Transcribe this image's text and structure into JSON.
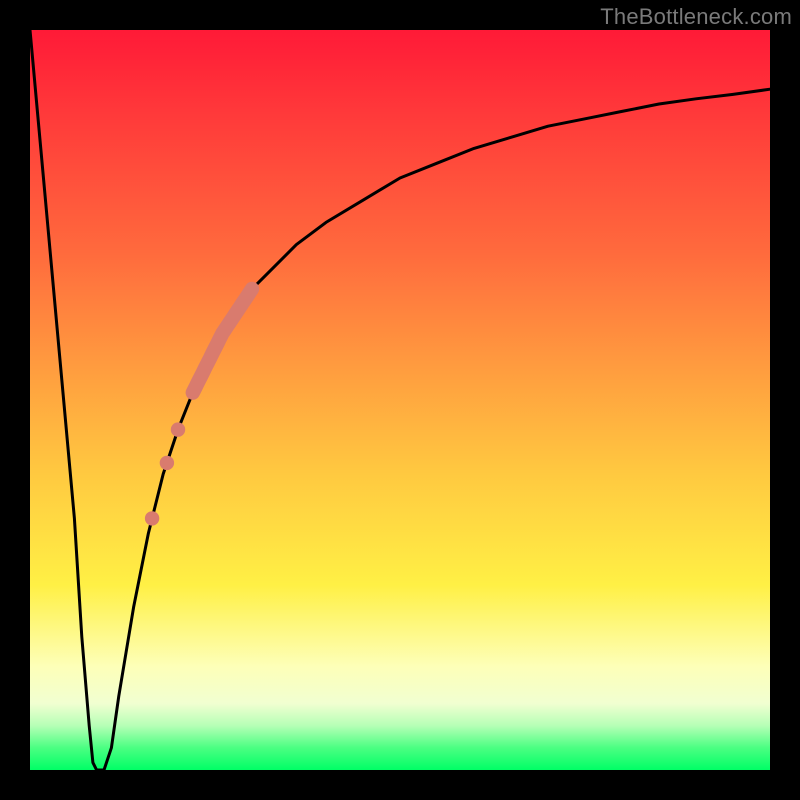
{
  "watermark": "TheBottleneck.com",
  "colors": {
    "background": "#000000",
    "curve": "#000000",
    "marker": "#d97b6e",
    "gradient_stops": [
      "#ff1a37",
      "#ff3b3a",
      "#ff6a3d",
      "#ff9a3f",
      "#ffc940",
      "#fff045",
      "#fdffb8",
      "#f1ffd1",
      "#b6ffb6",
      "#4bff82",
      "#00ff66"
    ]
  },
  "chart_data": {
    "type": "line",
    "title": "",
    "xlabel": "",
    "ylabel": "",
    "xlim": [
      0,
      100
    ],
    "ylim": [
      0,
      100
    ],
    "series": [
      {
        "name": "bottleneck-curve",
        "x": [
          0,
          2,
          4,
          6,
          7,
          8,
          8.5,
          9,
          9.5,
          10,
          11,
          12,
          14,
          16,
          18,
          20,
          22,
          24,
          26,
          28,
          30,
          33,
          36,
          40,
          45,
          50,
          55,
          60,
          65,
          70,
          75,
          80,
          85,
          90,
          95,
          100
        ],
        "values": [
          100,
          78,
          56,
          34,
          18,
          6,
          1,
          0,
          0,
          0,
          3,
          10,
          22,
          32,
          40,
          46,
          51,
          55,
          59,
          62,
          65,
          68,
          71,
          74,
          77,
          80,
          82,
          84,
          85.5,
          87,
          88,
          89,
          90,
          90.7,
          91.3,
          92
        ]
      }
    ],
    "markers": [
      {
        "name": "highlight-band",
        "type": "thick-segment",
        "x_range": [
          22,
          30
        ],
        "y_range": [
          51,
          65
        ],
        "width": 6
      },
      {
        "name": "dot-1",
        "type": "dot",
        "x": 20,
        "y": 46,
        "r": 4
      },
      {
        "name": "dot-2",
        "type": "dot",
        "x": 18.5,
        "y": 41.5,
        "r": 4
      },
      {
        "name": "dot-3",
        "type": "dot",
        "x": 16.5,
        "y": 34,
        "r": 4
      }
    ]
  }
}
